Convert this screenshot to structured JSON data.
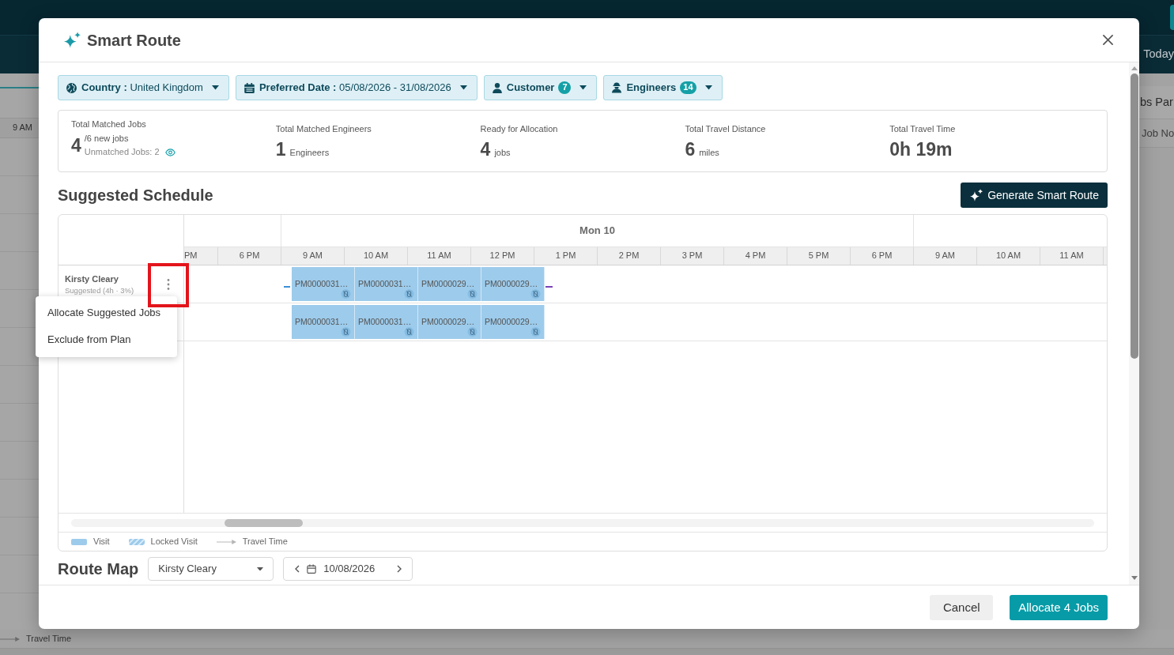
{
  "page_behind": {
    "toolbar_button": "Today",
    "panel_title": "bs Par",
    "panel_column": "Job No",
    "time_header": "9 AM",
    "legend_label": "Travel Time"
  },
  "dialog": {
    "title": "Smart Route",
    "filters": [
      {
        "kind": "country",
        "label": "Country :",
        "value": "United Kingdom"
      },
      {
        "kind": "date",
        "label": "Preferred Date :",
        "value": "05/08/2026 - 31/08/2026"
      },
      {
        "kind": "customer",
        "label": "Customer",
        "count": "7"
      },
      {
        "kind": "engineer",
        "label": "Engineers",
        "count": "14"
      }
    ],
    "stats": [
      {
        "label": "Total Matched Jobs",
        "value": "4",
        "unit": "/6 new jobs",
        "note": "Unmatched Jobs: 2"
      },
      {
        "label": "Total Matched Engineers",
        "value": "1",
        "unit": "Engineers"
      },
      {
        "label": "Ready for Allocation",
        "value": "4",
        "unit": "jobs"
      },
      {
        "label": "Total Travel Distance",
        "value": "6",
        "unit": "miles"
      },
      {
        "label": "Total Travel Time",
        "value": "0h 19m"
      }
    ],
    "schedule": {
      "title": "Suggested Schedule",
      "generate_button": "Generate Smart Route",
      "days": [
        {
          "hours": [
            "PM",
            "6 PM"
          ]
        },
        {
          "label": "Mon 10",
          "hours": [
            "9 AM",
            "10 AM",
            "11 AM",
            "12 PM",
            "1 PM",
            "2 PM",
            "3 PM",
            "4 PM",
            "5 PM",
            "6 PM"
          ]
        },
        {
          "hours": [
            "9 AM",
            "10 AM",
            "11 AM"
          ]
        }
      ],
      "rows": [
        {
          "name": "Kirsty Cleary",
          "status": "Suggested (4h · 3%)",
          "menu_button": {
            "highlighted": true
          },
          "travel_lines": [
            {
              "kind": "start",
              "color": "#3b8fd8"
            },
            {
              "kind": "end",
              "color": "#7a42b8"
            }
          ],
          "visits": [
            {
              "label": "PM0000031…",
              "locked": false
            },
            {
              "label": "PM0000031…",
              "locked": false
            },
            {
              "label": "PM0000029…",
              "locked": false
            },
            {
              "label": "PM0000029…",
              "locked": false
            }
          ]
        },
        {
          "visits": [
            {
              "label": "PM0000031…",
              "locked": false
            },
            {
              "label": "PM0000031…",
              "locked": false
            },
            {
              "label": "PM0000029…",
              "locked": false
            },
            {
              "label": "PM0000029…",
              "locked": false
            }
          ]
        }
      ],
      "context_menu": [
        "Allocate Suggested Jobs",
        "Exclude from Plan"
      ],
      "legend": [
        {
          "kind": "visit",
          "label": "Visit"
        },
        {
          "kind": "locked",
          "label": "Locked Visit"
        },
        {
          "kind": "travel",
          "label": "Travel Time"
        }
      ]
    },
    "route_map": {
      "title": "Route Map",
      "engineer": "Kirsty Cleary",
      "date": "10/08/2026"
    },
    "buttons": {
      "cancel": "Cancel",
      "confirm": "Allocate 4 Jobs"
    }
  }
}
